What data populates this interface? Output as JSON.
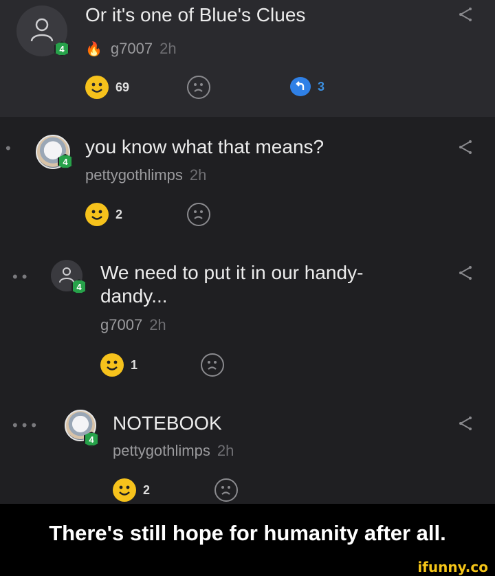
{
  "comments": [
    {
      "text": "Or it's one of Blue's Clues",
      "username": "g7007",
      "time": "2h",
      "level": "4",
      "likes": "69",
      "replies": "3",
      "avatar_icon": "default-user-icon",
      "badge_icon": "fire-icon"
    },
    {
      "text": "you know what that means?",
      "username": "pettygothlimps",
      "time": "2h",
      "level": "4",
      "likes": "2",
      "avatar_icon": "anime-avatar-icon"
    },
    {
      "text": "We need to put it in our handy-dandy...",
      "username": "g7007",
      "time": "2h",
      "level": "4",
      "likes": "1",
      "avatar_icon": "default-user-icon"
    },
    {
      "text": "NOTEBOOK",
      "username": "pettygothlimps",
      "time": "2h",
      "level": "4",
      "likes": "2",
      "avatar_icon": "anime-avatar-icon"
    }
  ],
  "caption": "There's still hope for humanity after all.",
  "watermark": "ifunny.co",
  "colors": {
    "smile": "#f6c21c",
    "reply": "#2f80e6",
    "level": "#27a24a",
    "background": "#1f1f22"
  }
}
